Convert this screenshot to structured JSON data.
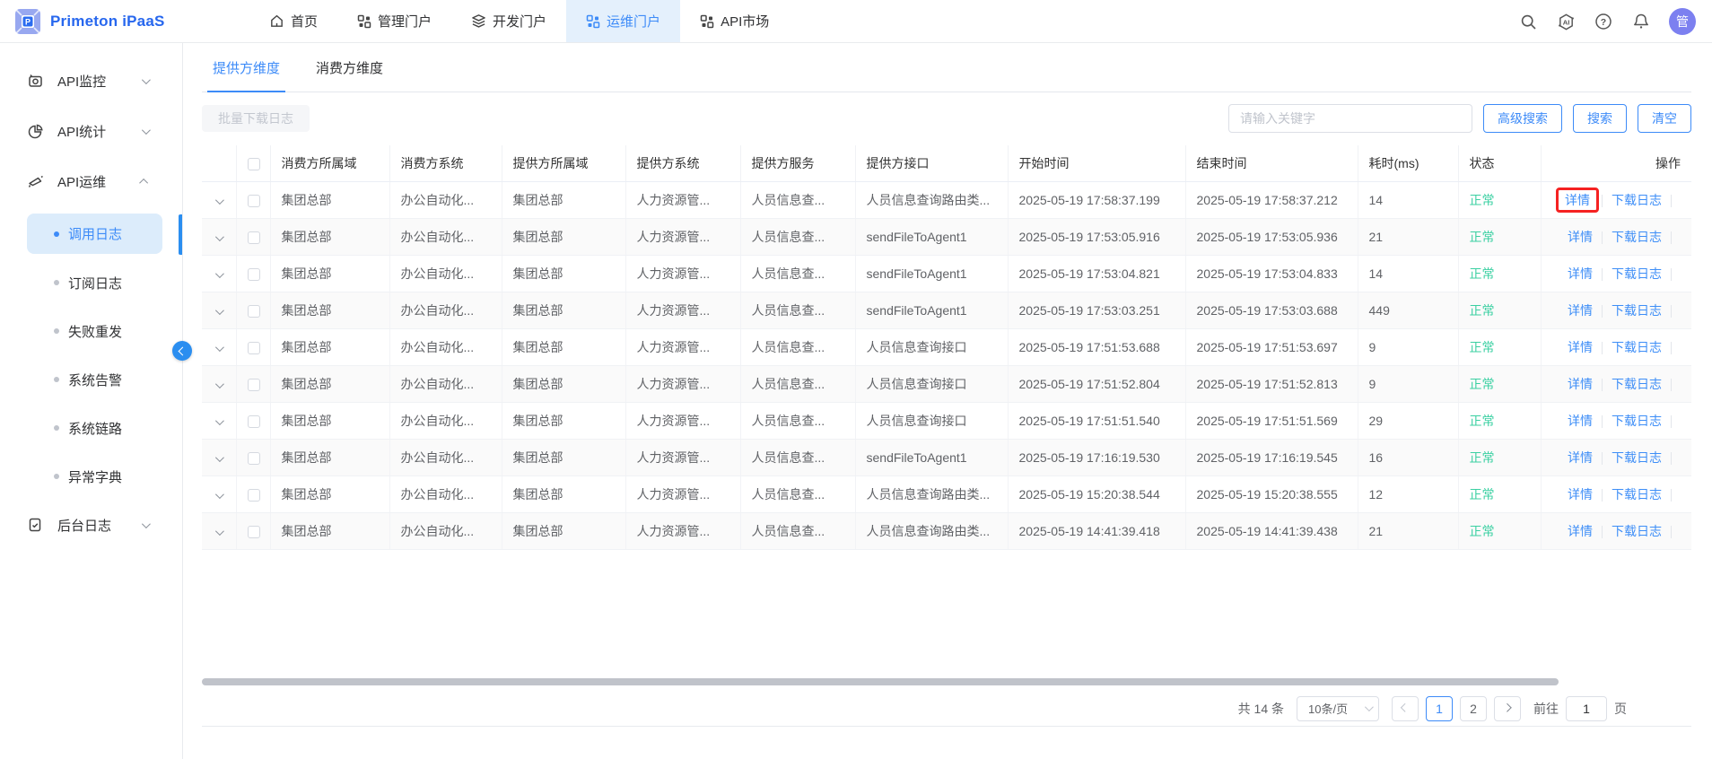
{
  "brand": {
    "name": "Primeton iPaaS",
    "logo_letter": "P"
  },
  "colors": {
    "primary_blue": "#3d8bf8",
    "brand_blue": "#2767ee",
    "success_green": "#3bd0a2",
    "annotation_red": "#f52222",
    "active_nav_bg": "#e4f0fc",
    "sidebar_active_bg": "#dcecfb"
  },
  "topnav": {
    "items": [
      {
        "label": "首页",
        "icon": "home-icon",
        "active": false
      },
      {
        "label": "管理门户",
        "icon": "grid-icon",
        "active": false
      },
      {
        "label": "开发门户",
        "icon": "layers-icon",
        "active": false
      },
      {
        "label": "运维门户",
        "icon": "grid-icon",
        "active": true
      },
      {
        "label": "API市场",
        "icon": "grid-icon",
        "active": false
      }
    ],
    "right_icons": [
      "search-icon",
      "ai-icon",
      "help-icon",
      "bell-icon"
    ],
    "avatar_text": "管"
  },
  "sidebar": {
    "groups": [
      {
        "label": "API监控",
        "icon": "monitor-icon",
        "expanded": false
      },
      {
        "label": "API统计",
        "icon": "pie-chart-icon",
        "expanded": false
      },
      {
        "label": "API运维",
        "icon": "megaphone-icon",
        "expanded": true
      },
      {
        "label": "后台日志",
        "icon": "document-icon",
        "expanded": false
      }
    ],
    "ops_children": [
      {
        "label": "调用日志",
        "active": true
      },
      {
        "label": "订阅日志",
        "active": false
      },
      {
        "label": "失败重发",
        "active": false
      },
      {
        "label": "系统告警",
        "active": false
      },
      {
        "label": "系统链路",
        "active": false
      },
      {
        "label": "异常字典",
        "active": false
      }
    ]
  },
  "tabs": [
    {
      "label": "提供方维度",
      "active": true
    },
    {
      "label": "消费方维度",
      "active": false
    }
  ],
  "toolbar": {
    "batch_download_label": "批量下载日志",
    "search_placeholder": "请输入关键字",
    "advanced_search_label": "高级搜索",
    "search_label": "搜索",
    "clear_label": "清空"
  },
  "table": {
    "columns": [
      "消费方所属域",
      "消费方系统",
      "提供方所属域",
      "提供方系统",
      "提供方服务",
      "提供方接口",
      "开始时间",
      "结束时间",
      "耗时(ms)",
      "状态",
      "操作"
    ],
    "actions": {
      "detail": "详情",
      "download": "下载日志"
    },
    "rows": [
      {
        "consumer_domain": "集团总部",
        "consumer_system": "办公自动化...",
        "provider_domain": "集团总部",
        "provider_system": "人力资源管...",
        "provider_service": "人员信息查...",
        "provider_interface": "人员信息查询路由类...",
        "start_time": "2025-05-19 17:58:37.199",
        "end_time": "2025-05-19 17:58:37.212",
        "duration_ms": "14",
        "status": "正常",
        "annotated": true
      },
      {
        "consumer_domain": "集团总部",
        "consumer_system": "办公自动化...",
        "provider_domain": "集团总部",
        "provider_system": "人力资源管...",
        "provider_service": "人员信息查...",
        "provider_interface": "sendFileToAgent1",
        "start_time": "2025-05-19 17:53:05.916",
        "end_time": "2025-05-19 17:53:05.936",
        "duration_ms": "21",
        "status": "正常",
        "annotated": false
      },
      {
        "consumer_domain": "集团总部",
        "consumer_system": "办公自动化...",
        "provider_domain": "集团总部",
        "provider_system": "人力资源管...",
        "provider_service": "人员信息查...",
        "provider_interface": "sendFileToAgent1",
        "start_time": "2025-05-19 17:53:04.821",
        "end_time": "2025-05-19 17:53:04.833",
        "duration_ms": "14",
        "status": "正常",
        "annotated": false
      },
      {
        "consumer_domain": "集团总部",
        "consumer_system": "办公自动化...",
        "provider_domain": "集团总部",
        "provider_system": "人力资源管...",
        "provider_service": "人员信息查...",
        "provider_interface": "sendFileToAgent1",
        "start_time": "2025-05-19 17:53:03.251",
        "end_time": "2025-05-19 17:53:03.688",
        "duration_ms": "449",
        "status": "正常",
        "annotated": false
      },
      {
        "consumer_domain": "集团总部",
        "consumer_system": "办公自动化...",
        "provider_domain": "集团总部",
        "provider_system": "人力资源管...",
        "provider_service": "人员信息查...",
        "provider_interface": "人员信息查询接口",
        "start_time": "2025-05-19 17:51:53.688",
        "end_time": "2025-05-19 17:51:53.697",
        "duration_ms": "9",
        "status": "正常",
        "annotated": false
      },
      {
        "consumer_domain": "集团总部",
        "consumer_system": "办公自动化...",
        "provider_domain": "集团总部",
        "provider_system": "人力资源管...",
        "provider_service": "人员信息查...",
        "provider_interface": "人员信息查询接口",
        "start_time": "2025-05-19 17:51:52.804",
        "end_time": "2025-05-19 17:51:52.813",
        "duration_ms": "9",
        "status": "正常",
        "annotated": false
      },
      {
        "consumer_domain": "集团总部",
        "consumer_system": "办公自动化...",
        "provider_domain": "集团总部",
        "provider_system": "人力资源管...",
        "provider_service": "人员信息查...",
        "provider_interface": "人员信息查询接口",
        "start_time": "2025-05-19 17:51:51.540",
        "end_time": "2025-05-19 17:51:51.569",
        "duration_ms": "29",
        "status": "正常",
        "annotated": false
      },
      {
        "consumer_domain": "集团总部",
        "consumer_system": "办公自动化...",
        "provider_domain": "集团总部",
        "provider_system": "人力资源管...",
        "provider_service": "人员信息查...",
        "provider_interface": "sendFileToAgent1",
        "start_time": "2025-05-19 17:16:19.530",
        "end_time": "2025-05-19 17:16:19.545",
        "duration_ms": "16",
        "status": "正常",
        "annotated": false
      },
      {
        "consumer_domain": "集团总部",
        "consumer_system": "办公自动化...",
        "provider_domain": "集团总部",
        "provider_system": "人力资源管...",
        "provider_service": "人员信息查...",
        "provider_interface": "人员信息查询路由类...",
        "start_time": "2025-05-19 15:20:38.544",
        "end_time": "2025-05-19 15:20:38.555",
        "duration_ms": "12",
        "status": "正常",
        "annotated": false
      },
      {
        "consumer_domain": "集团总部",
        "consumer_system": "办公自动化...",
        "provider_domain": "集团总部",
        "provider_system": "人力资源管...",
        "provider_service": "人员信息查...",
        "provider_interface": "人员信息查询路由类...",
        "start_time": "2025-05-19 14:41:39.418",
        "end_time": "2025-05-19 14:41:39.438",
        "duration_ms": "21",
        "status": "正常",
        "annotated": false
      }
    ]
  },
  "pagination": {
    "total_text": "共 14 条",
    "page_size": "10条/页",
    "pages": [
      "1",
      "2"
    ],
    "current_page": "1",
    "goto_prefix": "前往",
    "goto_value": "1",
    "goto_suffix": "页"
  }
}
